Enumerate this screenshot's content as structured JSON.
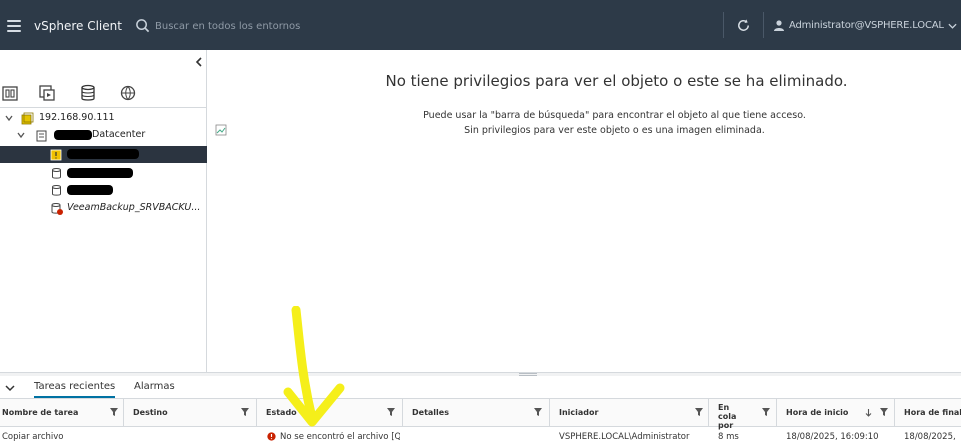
{
  "header": {
    "app_title": "vSphere Client",
    "search_placeholder": "Buscar en todos los entornos",
    "user": "Administrator@VSPHERE.LOCAL"
  },
  "navigator": {
    "tabs": [
      {
        "name": "hosts-clusters",
        "active": false
      },
      {
        "name": "vms-templates",
        "active": false
      },
      {
        "name": "storage",
        "active": true
      },
      {
        "name": "networking",
        "active": false
      }
    ],
    "tree": [
      {
        "label": "192.168.90.111",
        "type": "vcenter"
      },
      {
        "label": "Datacenter",
        "type": "datacenter"
      },
      {
        "label": "",
        "type": "datastore",
        "selected": true
      },
      {
        "label": "",
        "type": "datastore"
      },
      {
        "label": "",
        "type": "datastore"
      },
      {
        "label": "VeeamBackup_SRVBACKU...",
        "type": "datastore-error"
      }
    ]
  },
  "main": {
    "title": "No tiene privilegios para ver el objeto o este se ha eliminado.",
    "line1": "Puede usar la \"barra de búsqueda\" para encontrar el objeto al que tiene acceso.",
    "line2": "Sin privilegios para ver este objeto o es una imagen eliminada."
  },
  "tasks_panel": {
    "tabs": [
      "Tareas recientes",
      "Alarmas"
    ],
    "columns": [
      "Nombre de tarea",
      "Destino",
      "Estado",
      "Detalles",
      "Iniciador",
      "En cola por",
      "Hora de inicio",
      "Hora de finaliz"
    ],
    "rows": [
      {
        "task": "Copiar archivo",
        "target": "",
        "status": "No se encontró el archivo [Q",
        "details": "",
        "initiator": "VSPHERE.LOCAL\\Administrator",
        "queued": "8 ms",
        "start": "18/08/2025, 16:09:10",
        "end": "18/08/2025,"
      }
    ]
  },
  "colors": {
    "header_bg": "#2d3a48",
    "accent": "#0072a3",
    "error": "#c92100",
    "annotation": "#f5ef1a",
    "selected_row": "#2b3440"
  }
}
